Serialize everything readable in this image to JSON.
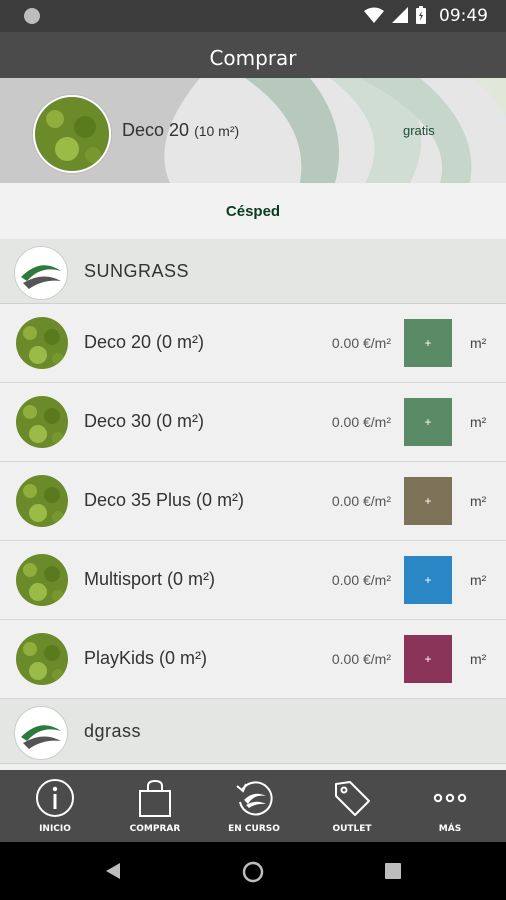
{
  "status_bar": {
    "time": "09:49"
  },
  "app_bar": {
    "title": "Comprar"
  },
  "banner": {
    "product": "Deco 20",
    "area": "(10 m²)",
    "price_note": "gratis"
  },
  "category": {
    "label": "Césped"
  },
  "brands": [
    {
      "name": "SUNGRASS",
      "products": [
        {
          "label": "Deco 20 (0 m²)",
          "price": "0.00 €/m²",
          "button": "+",
          "unit": "m²",
          "color": "#5b8a66"
        },
        {
          "label": "Deco 30 (0 m²)",
          "price": "0.00 €/m²",
          "button": "+",
          "unit": "m²",
          "color": "#5b8a66"
        },
        {
          "label": "Deco 35 Plus (0 m²)",
          "price": "0.00 €/m²",
          "button": "+",
          "unit": "m²",
          "color": "#7c7257"
        },
        {
          "label": "Multisport (0 m²)",
          "price": "0.00 €/m²",
          "button": "+",
          "unit": "m²",
          "color": "#2b86c5"
        },
        {
          "label": "PlayKids (0 m²)",
          "price": "0.00 €/m²",
          "button": "+",
          "unit": "m²",
          "color": "#8b3459"
        }
      ]
    },
    {
      "name": "dgrass",
      "products": []
    }
  ],
  "tabs": [
    {
      "label": "INICIO",
      "icon": "info-icon"
    },
    {
      "label": "COMPRAR",
      "icon": "shopping-bag-icon"
    },
    {
      "label": "EN CURSO",
      "icon": "in-progress-icon"
    },
    {
      "label": "OUTLET",
      "icon": "tag-icon"
    },
    {
      "label": "MÁS",
      "icon": "more-dots-icon"
    }
  ],
  "nav": {
    "icons": [
      "back-icon",
      "home-icon",
      "recents-icon"
    ]
  }
}
